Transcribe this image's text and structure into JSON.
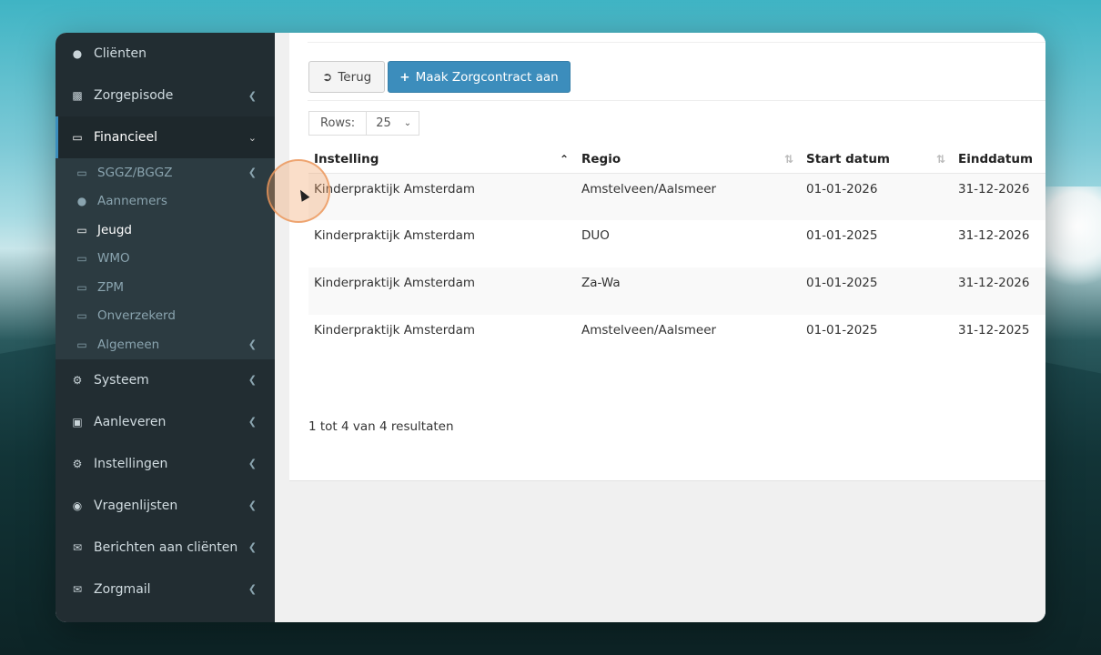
{
  "sidebar": {
    "items": [
      {
        "label": "Cliënten",
        "icon": "user-icon"
      },
      {
        "label": "Zorgepisode",
        "icon": "medkit-icon"
      },
      {
        "label": "Financieel",
        "icon": "book-icon"
      },
      {
        "label": "Systeem",
        "icon": "gears-icon"
      },
      {
        "label": "Aanleveren",
        "icon": "truck-icon"
      },
      {
        "label": "Instellingen",
        "icon": "gear-icon"
      },
      {
        "label": "Vragenlijsten",
        "icon": "globe-icon"
      },
      {
        "label": "Berichten aan cliënten",
        "icon": "envelope-icon"
      },
      {
        "label": "Zorgmail",
        "icon": "envelope-icon"
      }
    ],
    "financieel_sub": [
      {
        "label": "SGGZ/BGGZ"
      },
      {
        "label": "Aannemers"
      },
      {
        "label": "Jeugd"
      },
      {
        "label": "WMO"
      },
      {
        "label": "ZPM"
      },
      {
        "label": "Onverzekerd"
      },
      {
        "label": "Algemeen"
      }
    ]
  },
  "toolbar": {
    "back_label": "Terug",
    "create_label": "Maak Zorgcontract aan"
  },
  "rows": {
    "label": "Rows:",
    "value": "25"
  },
  "table": {
    "headers": [
      "Instelling",
      "Regio",
      "Start datum",
      "Einddatum"
    ],
    "rows": [
      [
        "Kinderpraktijk Amsterdam",
        "Amstelveen/Aalsmeer",
        "01-01-2026",
        "31-12-2026"
      ],
      [
        "Kinderpraktijk Amsterdam",
        "DUO",
        "01-01-2025",
        "31-12-2026"
      ],
      [
        "Kinderpraktijk Amsterdam",
        "Za-Wa",
        "01-01-2025",
        "31-12-2026"
      ],
      [
        "Kinderpraktijk Amsterdam",
        "Amstelveen/Aalsmeer",
        "01-01-2025",
        "31-12-2025"
      ]
    ]
  },
  "result_text": "1 tot 4 van 4 resultaten",
  "colors": {
    "sidebar": "#222d32",
    "accent": "#3c8dbc"
  }
}
